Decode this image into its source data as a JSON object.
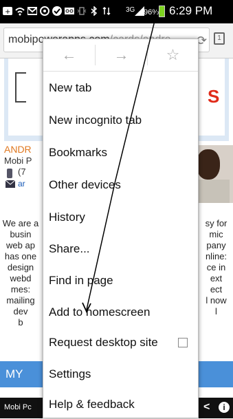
{
  "status_bar": {
    "signal_label": "3G",
    "battery": "96%",
    "time": "6:29 PM"
  },
  "url_bar": {
    "domain": "mobipowerapps.com",
    "path": "/cards/andre",
    "tab_count": "1"
  },
  "page": {
    "logo_letter": "S",
    "name": "ANDR",
    "company": "Mobi P",
    "phone": "(7",
    "email": "ar",
    "description_left": "We are a\nbusin\nweb ap\nhas one\ndesign\nwebd\nmes:\nmailing\ndev\nb",
    "description_right": "sy for\nmic\npany\nnline:\nce in\next\nect\nl now\nl",
    "bottom_bar": "MY",
    "footer_text": "Mobi Pc"
  },
  "menu": {
    "back_icon": "←",
    "forward_icon": "→",
    "bookmark_icon": "☆",
    "items": [
      {
        "label": "New tab"
      },
      {
        "label": "New incognito tab"
      },
      {
        "label": "Bookmarks"
      },
      {
        "label": "Other devices"
      },
      {
        "label": "History"
      },
      {
        "label": "Share..."
      },
      {
        "label": "Find in page"
      },
      {
        "label": "Add to homescreen"
      },
      {
        "label": "Request desktop site"
      },
      {
        "label": "Settings"
      },
      {
        "label": "Help & feedback"
      }
    ]
  }
}
